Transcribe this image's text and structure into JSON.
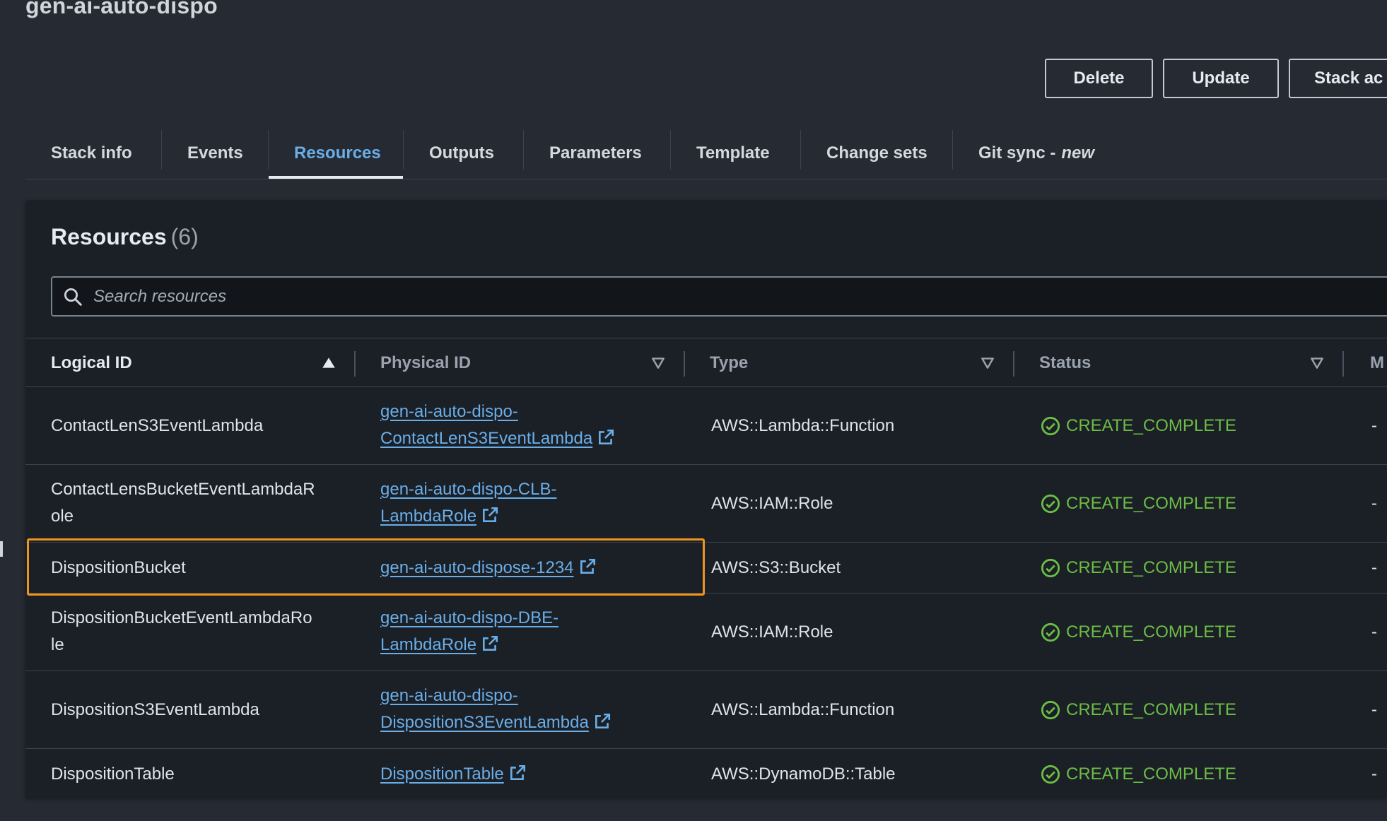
{
  "stack": {
    "name": "gen-ai-auto-dispo"
  },
  "actions": {
    "delete": "Delete",
    "update": "Update",
    "stack_actions": "Stack ac"
  },
  "tabs": [
    {
      "label": "Stack info",
      "active": false
    },
    {
      "label": "Events",
      "active": false
    },
    {
      "label": "Resources",
      "active": true
    },
    {
      "label": "Outputs",
      "active": false
    },
    {
      "label": "Parameters",
      "active": false
    },
    {
      "label": "Template",
      "active": false
    },
    {
      "label": "Change sets",
      "active": false
    },
    {
      "label": "Git sync -",
      "badge": "new",
      "active": false
    }
  ],
  "resources": {
    "heading": "Resources",
    "count": "(6)",
    "search_placeholder": "Search resources",
    "columns": {
      "logical_id": "Logical ID",
      "physical_id": "Physical ID",
      "type": "Type",
      "status": "Status",
      "more": "M"
    },
    "rows": [
      {
        "logical_id": [
          "ContactLenS3EventLambda"
        ],
        "physical_id": [
          "gen-ai-auto-dispo-",
          "ContactLenS3EventLambda"
        ],
        "type": "AWS::Lambda::Function",
        "status": "CREATE_COMPLETE",
        "more": "-"
      },
      {
        "logical_id": [
          "ContactLensBucketEventLambdaR",
          "ole"
        ],
        "physical_id": [
          "gen-ai-auto-dispo-CLB-",
          "LambdaRole"
        ],
        "type": "AWS::IAM::Role",
        "status": "CREATE_COMPLETE",
        "more": "-"
      },
      {
        "logical_id": [
          "DispositionBucket"
        ],
        "physical_id": [
          "gen-ai-auto-dispose-1234"
        ],
        "type": "AWS::S3::Bucket",
        "status": "CREATE_COMPLETE",
        "more": "-"
      },
      {
        "logical_id": [
          "DispositionBucketEventLambdaRo",
          "le"
        ],
        "physical_id": [
          "gen-ai-auto-dispo-DBE-",
          "LambdaRole"
        ],
        "type": "AWS::IAM::Role",
        "status": "CREATE_COMPLETE",
        "more": "-"
      },
      {
        "logical_id": [
          "DispositionS3EventLambda"
        ],
        "physical_id": [
          "gen-ai-auto-dispo-",
          "DispositionS3EventLambda"
        ],
        "type": "AWS::Lambda::Function",
        "status": "CREATE_COMPLETE",
        "more": "-"
      },
      {
        "logical_id": [
          "DispositionTable"
        ],
        "physical_id": [
          "DispositionTable"
        ],
        "type": "AWS::DynamoDB::Table",
        "status": "CREATE_COMPLETE",
        "more": "-"
      }
    ]
  },
  "colors": {
    "background": "#252a33",
    "panel": "#1b1f26",
    "link": "#6aaee8",
    "success": "#6cbd45",
    "highlight": "#f0931c"
  }
}
